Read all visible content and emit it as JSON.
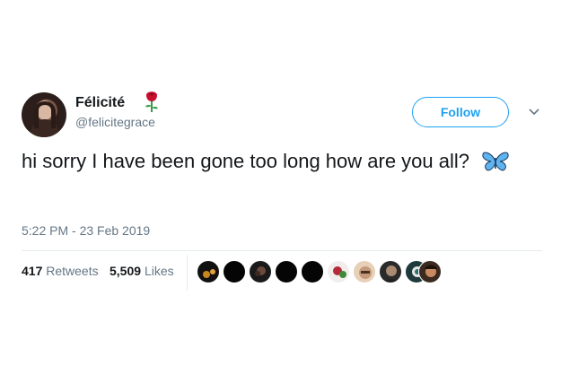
{
  "user": {
    "display_name": "Félicité",
    "handle": "@felicitegrace"
  },
  "actions": {
    "follow_label": "Follow"
  },
  "tweet": {
    "text": "hi sorry I have been gone too long how are you all?",
    "timestamp": "5:22 PM - 23 Feb 2019"
  },
  "stats": {
    "retweets_count": "417",
    "retweets_label": "Retweets",
    "likes_count": "5,509",
    "likes_label": "Likes"
  },
  "icons": {
    "name_emoji": "rose-icon",
    "text_emoji": "butterfly-icon",
    "menu": "chevron-down-icon"
  },
  "colors": {
    "accent": "#1da1f2",
    "secondary_text": "#657786",
    "divider": "#e6ecf0"
  }
}
